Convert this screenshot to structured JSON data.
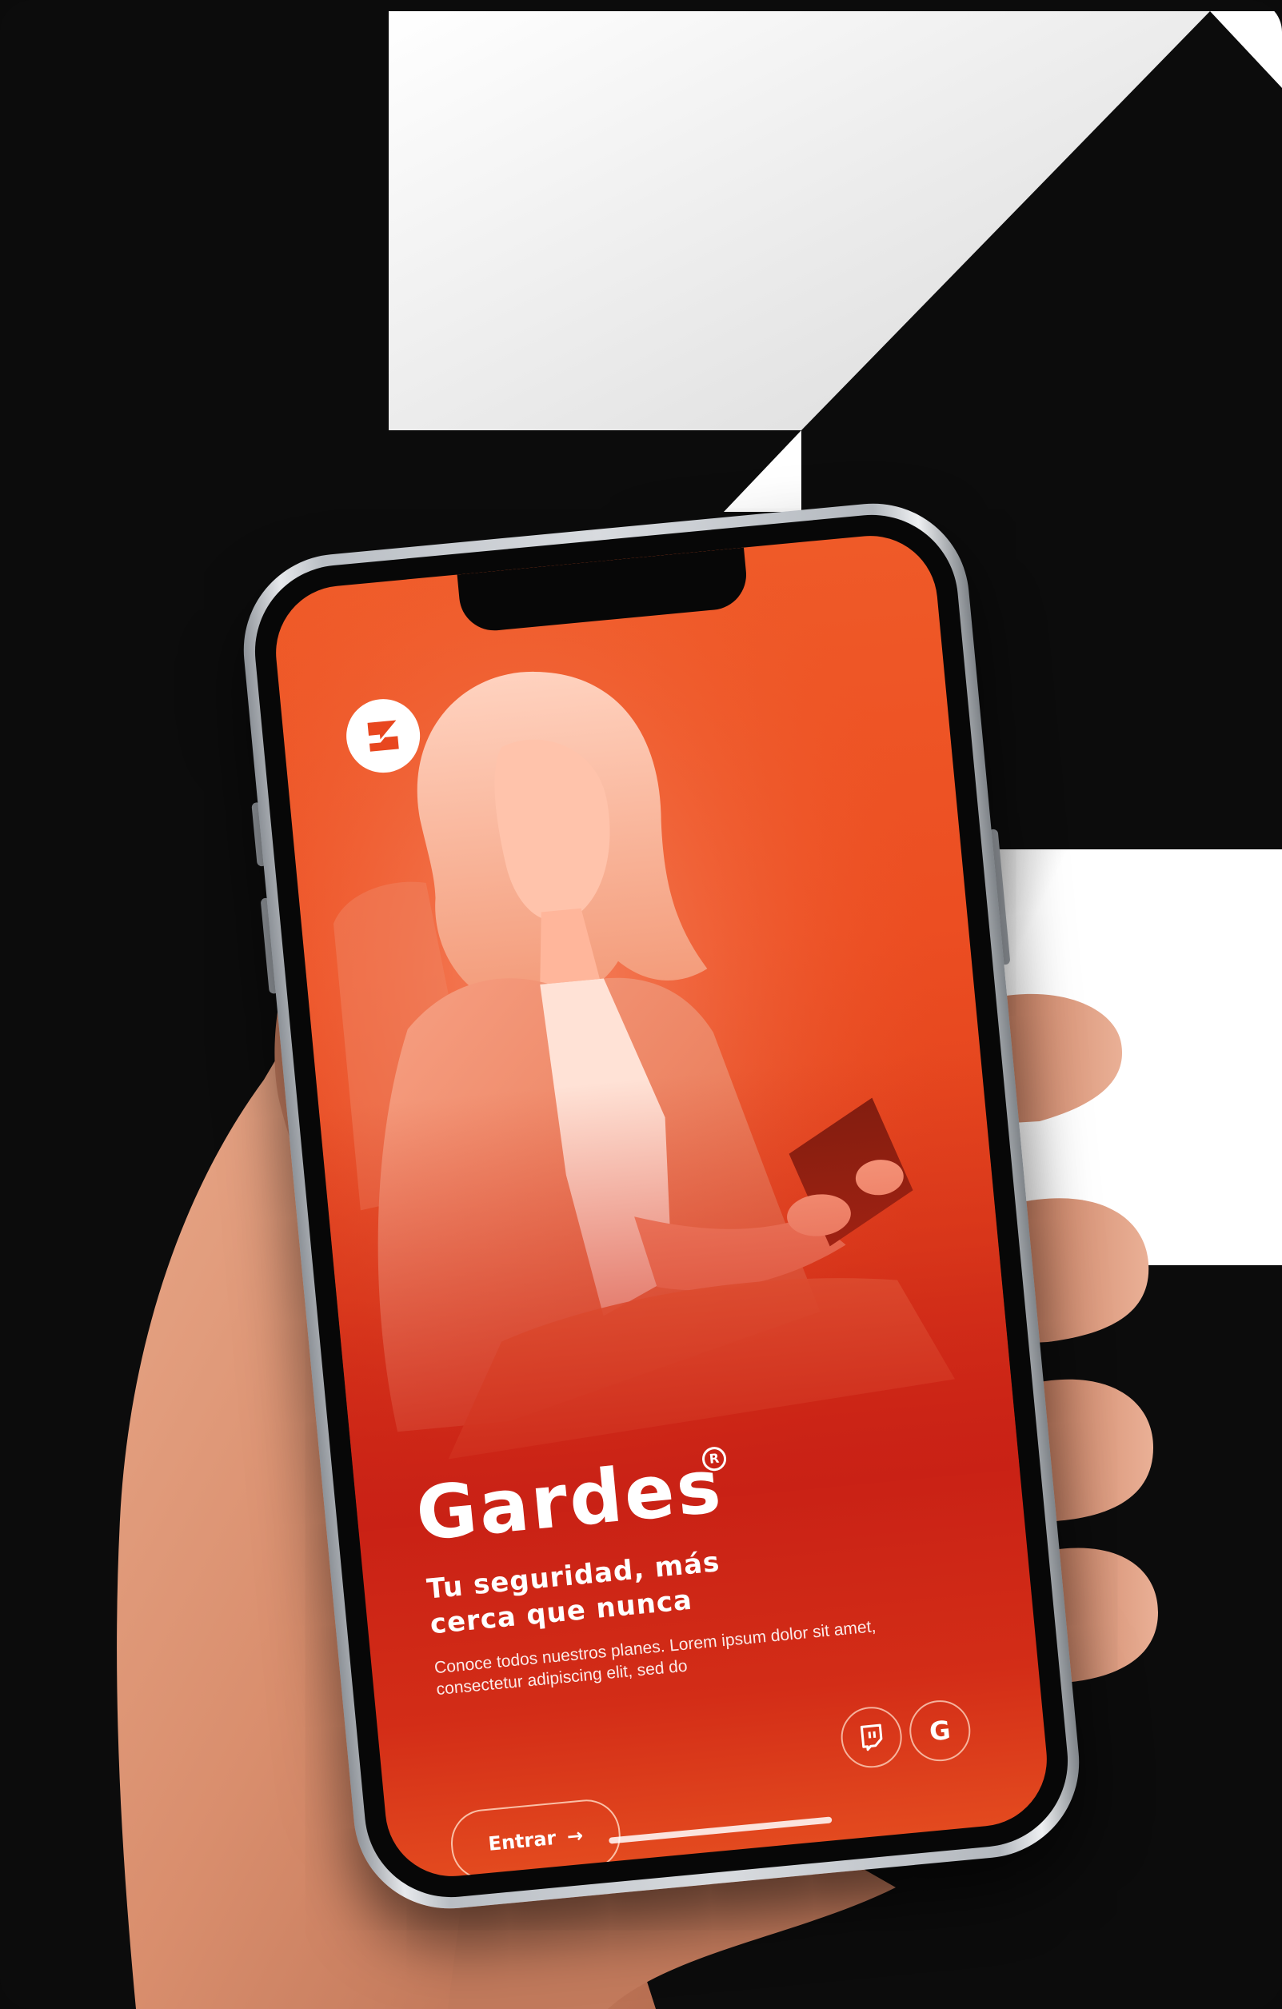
{
  "app": {
    "brand_name": "Gardes",
    "registered_mark": "R",
    "tagline": "Tu seguridad, más cerca que nunca",
    "description": "Conoce todos nuestros planes. Lorem ipsum dolor sit amet, consectetur adipiscing elit, sed do",
    "enter_label": "Entrar",
    "enter_arrow": "→",
    "social": {
      "twitch_icon": "twitch-icon",
      "google_label": "G"
    }
  },
  "colors": {
    "background": "#0c0c0c",
    "screen_orange": "#ef5a28",
    "screen_red": "#c92115",
    "white": "#ffffff"
  }
}
